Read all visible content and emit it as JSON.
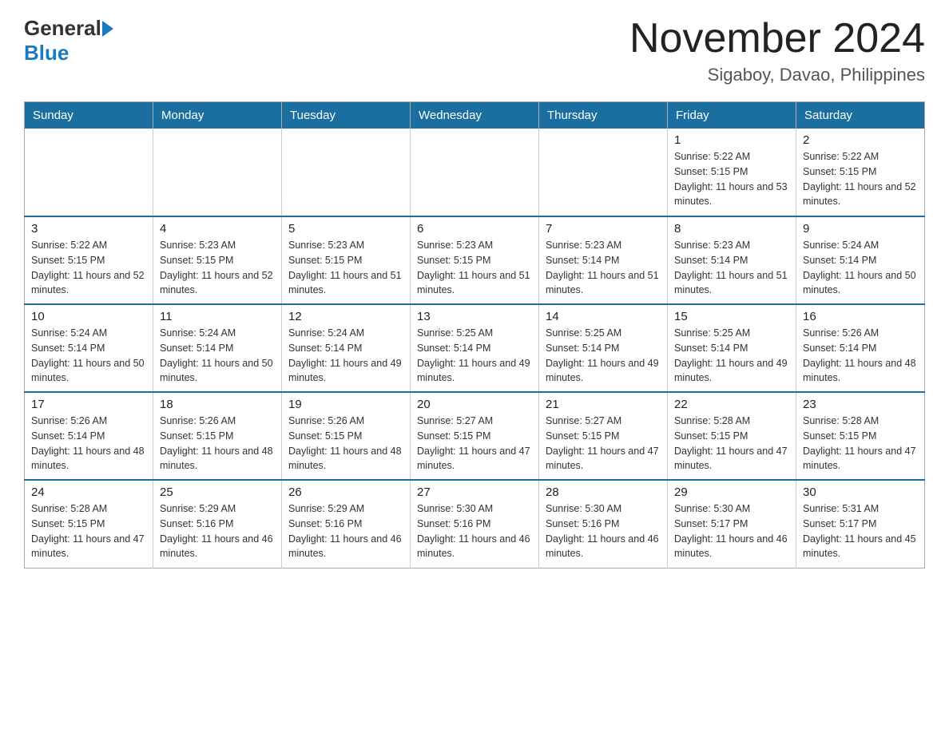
{
  "header": {
    "logo_general": "General",
    "logo_blue": "Blue",
    "month_title": "November 2024",
    "location": "Sigaboy, Davao, Philippines"
  },
  "weekdays": [
    "Sunday",
    "Monday",
    "Tuesday",
    "Wednesday",
    "Thursday",
    "Friday",
    "Saturday"
  ],
  "weeks": [
    [
      {
        "day": "",
        "info": ""
      },
      {
        "day": "",
        "info": ""
      },
      {
        "day": "",
        "info": ""
      },
      {
        "day": "",
        "info": ""
      },
      {
        "day": "",
        "info": ""
      },
      {
        "day": "1",
        "info": "Sunrise: 5:22 AM\nSunset: 5:15 PM\nDaylight: 11 hours and 53 minutes."
      },
      {
        "day": "2",
        "info": "Sunrise: 5:22 AM\nSunset: 5:15 PM\nDaylight: 11 hours and 52 minutes."
      }
    ],
    [
      {
        "day": "3",
        "info": "Sunrise: 5:22 AM\nSunset: 5:15 PM\nDaylight: 11 hours and 52 minutes."
      },
      {
        "day": "4",
        "info": "Sunrise: 5:23 AM\nSunset: 5:15 PM\nDaylight: 11 hours and 52 minutes."
      },
      {
        "day": "5",
        "info": "Sunrise: 5:23 AM\nSunset: 5:15 PM\nDaylight: 11 hours and 51 minutes."
      },
      {
        "day": "6",
        "info": "Sunrise: 5:23 AM\nSunset: 5:15 PM\nDaylight: 11 hours and 51 minutes."
      },
      {
        "day": "7",
        "info": "Sunrise: 5:23 AM\nSunset: 5:14 PM\nDaylight: 11 hours and 51 minutes."
      },
      {
        "day": "8",
        "info": "Sunrise: 5:23 AM\nSunset: 5:14 PM\nDaylight: 11 hours and 51 minutes."
      },
      {
        "day": "9",
        "info": "Sunrise: 5:24 AM\nSunset: 5:14 PM\nDaylight: 11 hours and 50 minutes."
      }
    ],
    [
      {
        "day": "10",
        "info": "Sunrise: 5:24 AM\nSunset: 5:14 PM\nDaylight: 11 hours and 50 minutes."
      },
      {
        "day": "11",
        "info": "Sunrise: 5:24 AM\nSunset: 5:14 PM\nDaylight: 11 hours and 50 minutes."
      },
      {
        "day": "12",
        "info": "Sunrise: 5:24 AM\nSunset: 5:14 PM\nDaylight: 11 hours and 49 minutes."
      },
      {
        "day": "13",
        "info": "Sunrise: 5:25 AM\nSunset: 5:14 PM\nDaylight: 11 hours and 49 minutes."
      },
      {
        "day": "14",
        "info": "Sunrise: 5:25 AM\nSunset: 5:14 PM\nDaylight: 11 hours and 49 minutes."
      },
      {
        "day": "15",
        "info": "Sunrise: 5:25 AM\nSunset: 5:14 PM\nDaylight: 11 hours and 49 minutes."
      },
      {
        "day": "16",
        "info": "Sunrise: 5:26 AM\nSunset: 5:14 PM\nDaylight: 11 hours and 48 minutes."
      }
    ],
    [
      {
        "day": "17",
        "info": "Sunrise: 5:26 AM\nSunset: 5:14 PM\nDaylight: 11 hours and 48 minutes."
      },
      {
        "day": "18",
        "info": "Sunrise: 5:26 AM\nSunset: 5:15 PM\nDaylight: 11 hours and 48 minutes."
      },
      {
        "day": "19",
        "info": "Sunrise: 5:26 AM\nSunset: 5:15 PM\nDaylight: 11 hours and 48 minutes."
      },
      {
        "day": "20",
        "info": "Sunrise: 5:27 AM\nSunset: 5:15 PM\nDaylight: 11 hours and 47 minutes."
      },
      {
        "day": "21",
        "info": "Sunrise: 5:27 AM\nSunset: 5:15 PM\nDaylight: 11 hours and 47 minutes."
      },
      {
        "day": "22",
        "info": "Sunrise: 5:28 AM\nSunset: 5:15 PM\nDaylight: 11 hours and 47 minutes."
      },
      {
        "day": "23",
        "info": "Sunrise: 5:28 AM\nSunset: 5:15 PM\nDaylight: 11 hours and 47 minutes."
      }
    ],
    [
      {
        "day": "24",
        "info": "Sunrise: 5:28 AM\nSunset: 5:15 PM\nDaylight: 11 hours and 47 minutes."
      },
      {
        "day": "25",
        "info": "Sunrise: 5:29 AM\nSunset: 5:16 PM\nDaylight: 11 hours and 46 minutes."
      },
      {
        "day": "26",
        "info": "Sunrise: 5:29 AM\nSunset: 5:16 PM\nDaylight: 11 hours and 46 minutes."
      },
      {
        "day": "27",
        "info": "Sunrise: 5:30 AM\nSunset: 5:16 PM\nDaylight: 11 hours and 46 minutes."
      },
      {
        "day": "28",
        "info": "Sunrise: 5:30 AM\nSunset: 5:16 PM\nDaylight: 11 hours and 46 minutes."
      },
      {
        "day": "29",
        "info": "Sunrise: 5:30 AM\nSunset: 5:17 PM\nDaylight: 11 hours and 46 minutes."
      },
      {
        "day": "30",
        "info": "Sunrise: 5:31 AM\nSunset: 5:17 PM\nDaylight: 11 hours and 45 minutes."
      }
    ]
  ]
}
